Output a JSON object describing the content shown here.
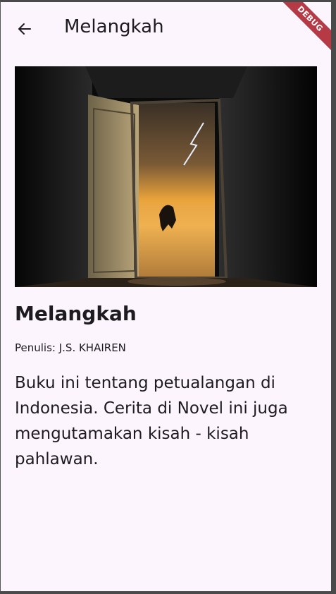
{
  "appbar": {
    "title": "Melangkah",
    "back_icon": "arrow-left-icon"
  },
  "debug_banner": "DEBUG",
  "book": {
    "cover_alt": "book-cover",
    "title": "Melangkah",
    "author": "Penulis: J.S. KHAIREN",
    "description": "Buku ini tentang petualangan di Indonesia. Cerita di Novel ini juga mengutamakan kisah - kisah pahlawan."
  }
}
